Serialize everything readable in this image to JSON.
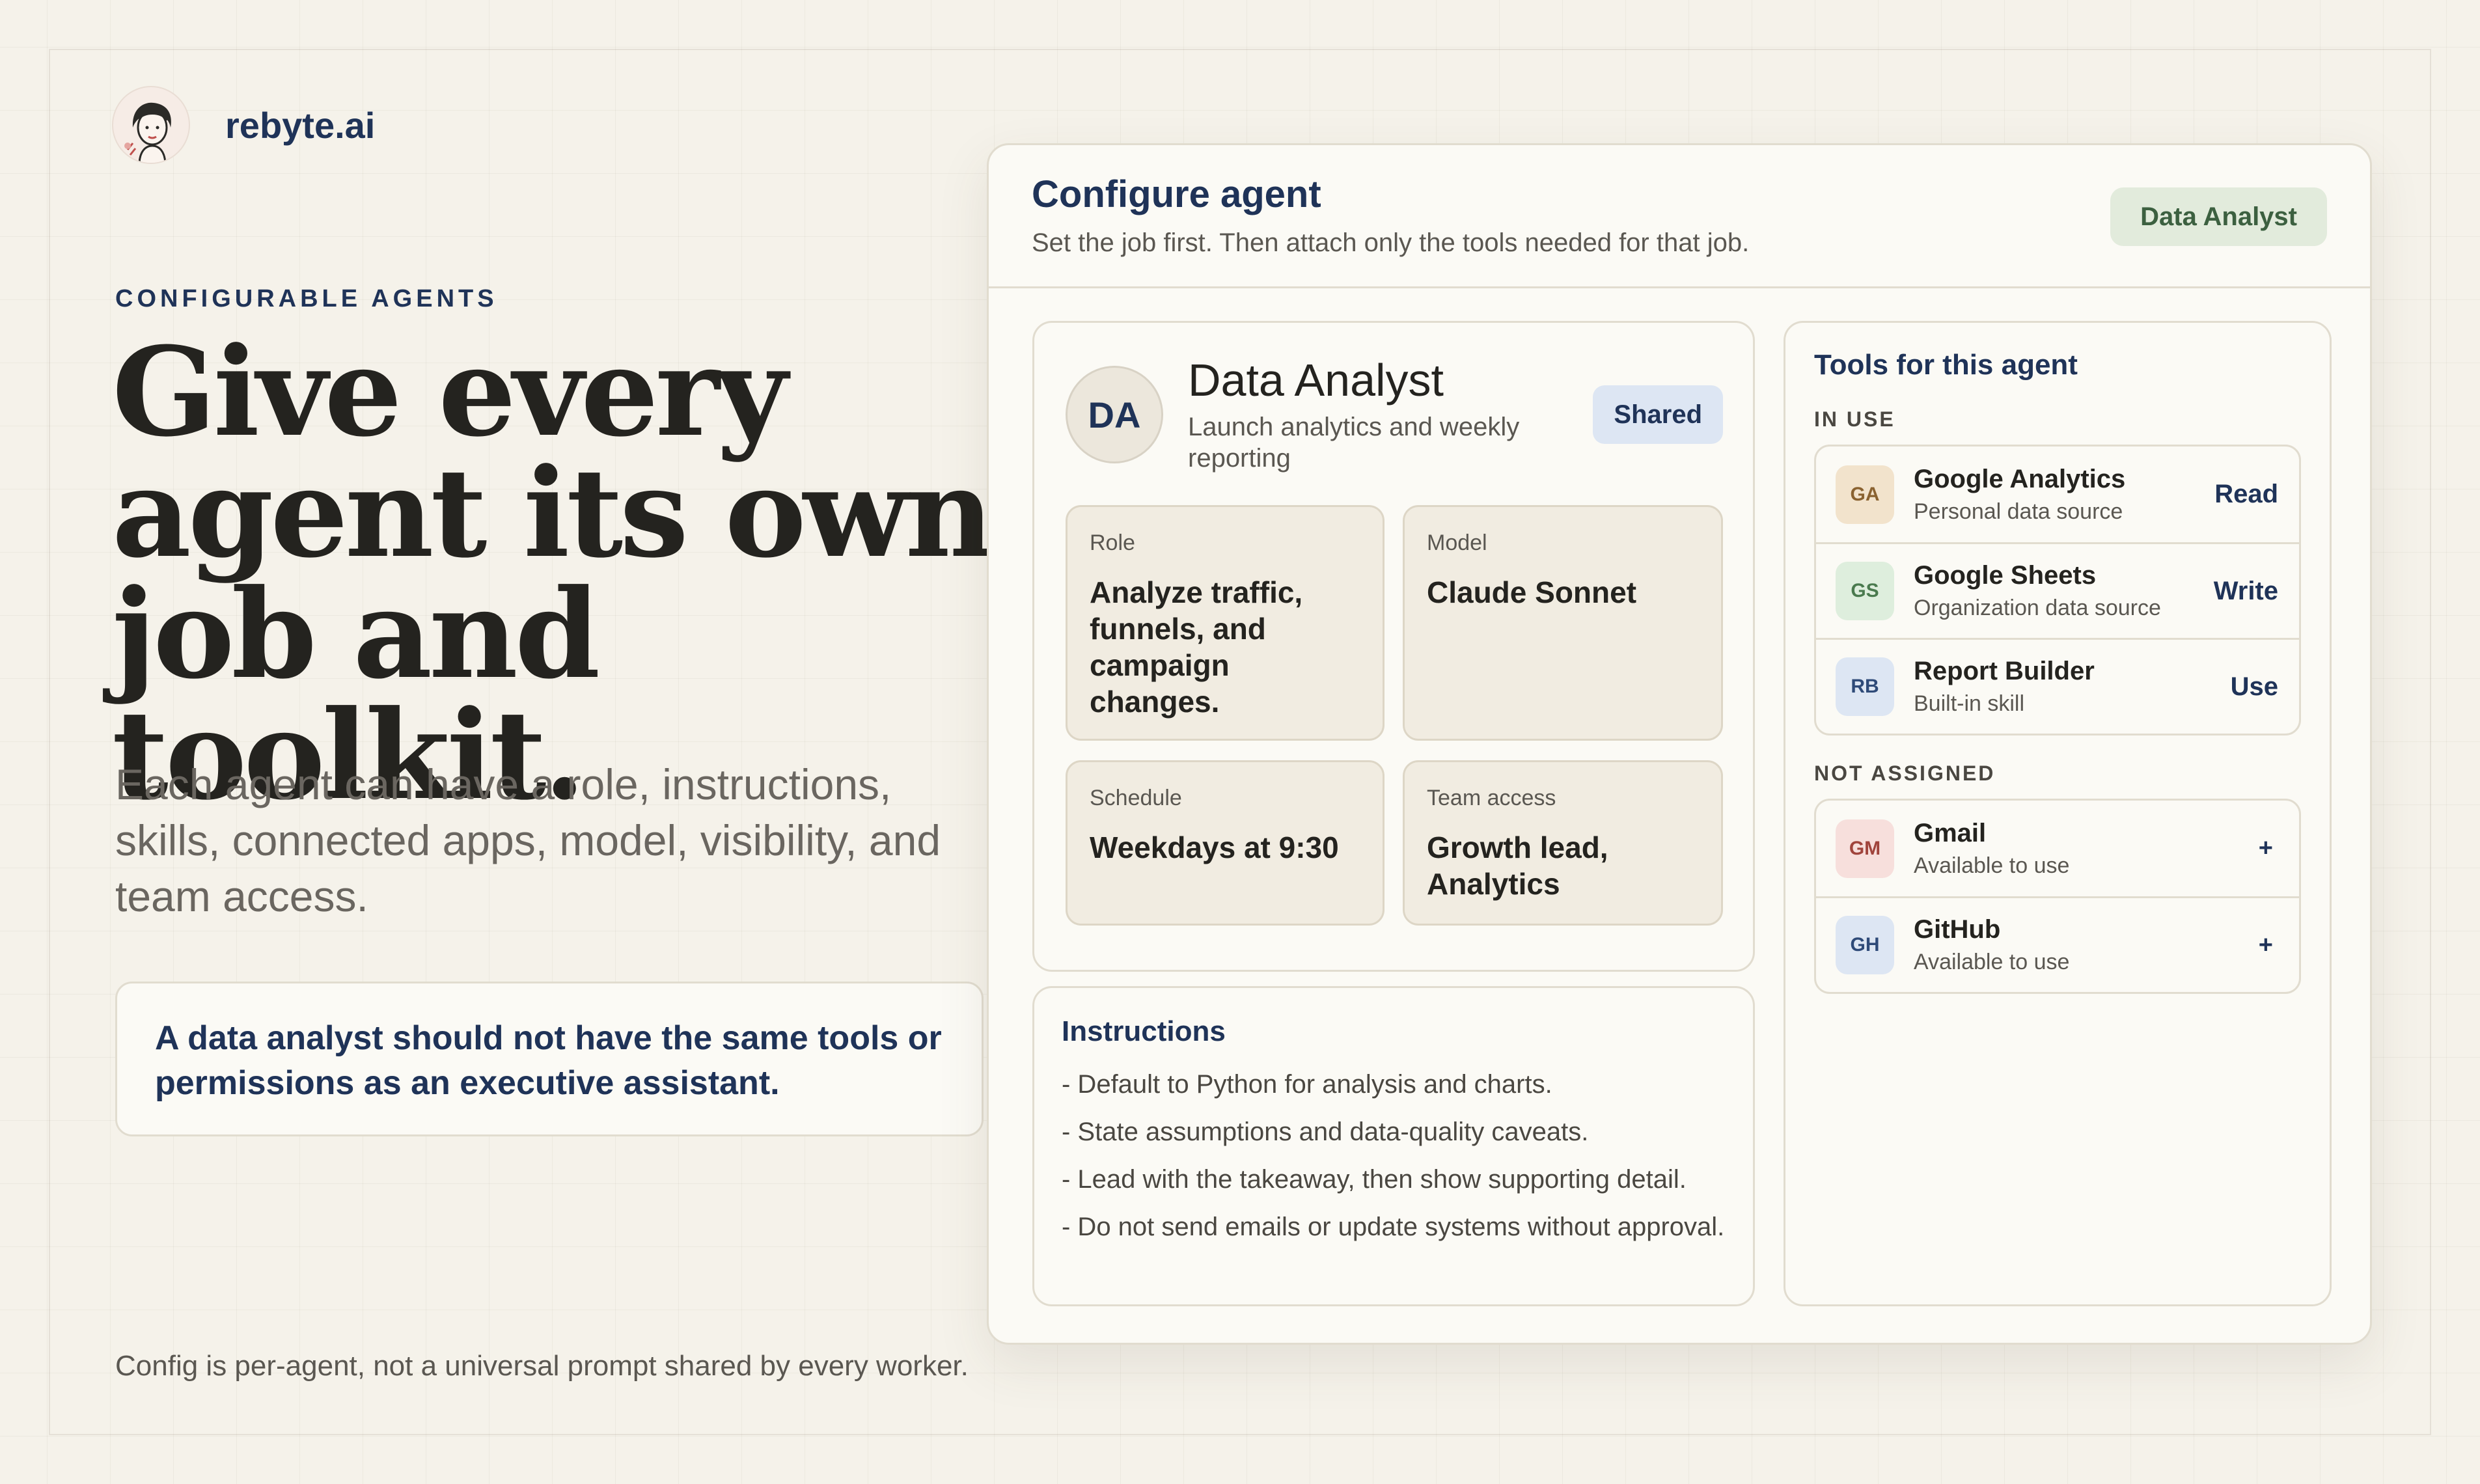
{
  "brand": {
    "name": "rebyte.ai",
    "logo_icon": "woman-portrait-logo"
  },
  "hero": {
    "eyebrow": "CONFIGURABLE AGENTS",
    "headline_lines": [
      "Give every",
      "agent its own",
      "job and toolkit."
    ],
    "subtext": "Each agent can have a role, instructions, skills, connected apps, model, visibility, and team access.",
    "callout": "A data analyst should not have the same tools or permissions as an executive assistant.",
    "footnote": "Config is per-agent, not a universal prompt shared by every worker."
  },
  "panel": {
    "title": "Configure agent",
    "subtitle": "Set the job first. Then attach only the tools needed for that job.",
    "tag": "Data Analyst",
    "agent": {
      "initials": "DA",
      "name": "Data Analyst",
      "description": "Launch analytics and weekly reporting",
      "badge": "Shared",
      "fields": {
        "role": {
          "label": "Role",
          "value": "Analyze traffic, funnels, and campaign changes."
        },
        "model": {
          "label": "Model",
          "value": "Claude Sonnet"
        },
        "schedule": {
          "label": "Schedule",
          "value": "Weekdays at 9:30"
        },
        "team": {
          "label": "Team access",
          "value": "Growth lead, Analytics"
        }
      }
    },
    "instructions": {
      "title": "Instructions",
      "items": [
        "- Default to Python for analysis and charts.",
        "- State assumptions and data-quality caveats.",
        "- Lead with the takeaway, then show supporting detail.",
        "- Do not send emails or update systems without approval."
      ]
    },
    "tools": {
      "title": "Tools for this agent",
      "in_use_label": "IN USE",
      "not_assigned_label": "NOT ASSIGNED",
      "in_use": [
        {
          "abbr": "GA",
          "name": "Google Analytics",
          "desc": "Personal data source",
          "perm": "Read",
          "bg": "#f2e3cc",
          "fg": "#8a6230"
        },
        {
          "abbr": "GS",
          "name": "Google Sheets",
          "desc": "Organization data source",
          "perm": "Write",
          "bg": "#deeedd",
          "fg": "#4a7a4e"
        },
        {
          "abbr": "RB",
          "name": "Report Builder",
          "desc": "Built-in skill",
          "perm": "Use",
          "bg": "#dde6f3",
          "fg": "#2e4a78"
        }
      ],
      "not_assigned": [
        {
          "abbr": "GM",
          "name": "Gmail",
          "desc": "Available to use",
          "action": "+",
          "bg": "#f7dfdc",
          "fg": "#a0443c"
        },
        {
          "abbr": "GH",
          "name": "GitHub",
          "desc": "Available to use",
          "action": "+",
          "bg": "#dde6f3",
          "fg": "#2e4a78"
        }
      ]
    }
  }
}
